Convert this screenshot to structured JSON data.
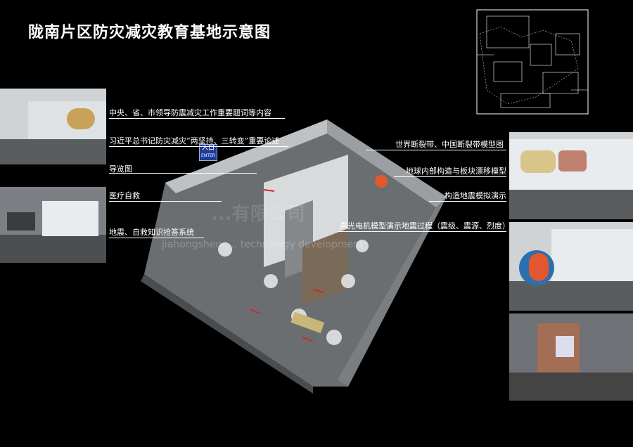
{
  "title": "陇南片区防灾减灾教育基地示意图",
  "entry": {
    "cn": "入口",
    "en": "ENTER"
  },
  "left_labels": [
    "中央、省、市领导防震减灾工作重要题词等内容",
    "习近平总书记防灾减灾“两坚持、三转变”重要论述",
    "导览图",
    "医疗自救",
    "地震、自救知识抢答系统"
  ],
  "right_labels": [
    "世界断裂带、中国断裂带模型图",
    "地球内部构造与板块漂移模型",
    "构造地震模拟演示",
    "声光电机模型演示地震过程（震级、震源、烈度）"
  ],
  "watermark": {
    "en": "jiahongsheng... technology development",
    "cn": "...有限公司"
  },
  "colors": {
    "background": "#000000",
    "entry": "#1c3d9a",
    "accent_red": "#d0262b"
  }
}
